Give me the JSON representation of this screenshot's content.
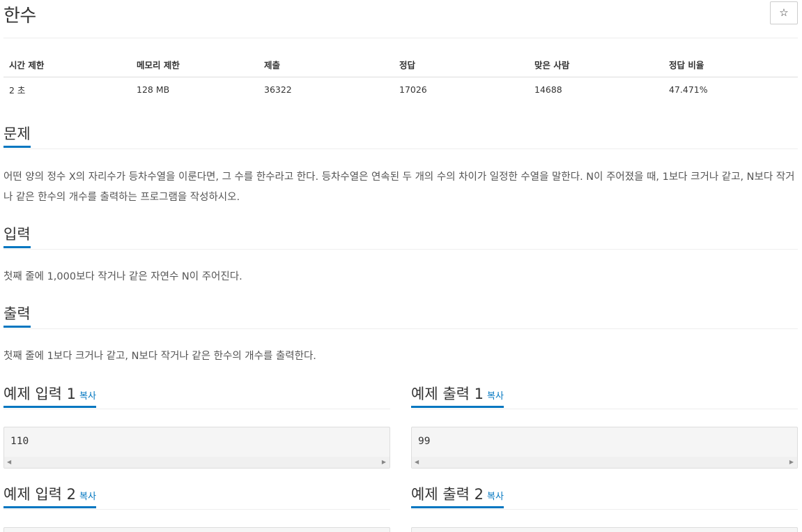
{
  "problem": {
    "title": "한수",
    "star_icon": "☆"
  },
  "info_table": {
    "headers": [
      "시간 제한",
      "메모리 제한",
      "제출",
      "정답",
      "맞은 사람",
      "정답 비율"
    ],
    "values": [
      "2 초",
      "128 MB",
      "36322",
      "17026",
      "14688",
      "47.471%"
    ]
  },
  "sections": {
    "description": {
      "heading": "문제",
      "text": "어떤 양의 정수 X의 자리수가 등차수열을 이룬다면, 그 수를 한수라고 한다. 등차수열은 연속된 두 개의 수의 차이가 일정한 수열을 말한다. N이 주어졌을 때, 1보다 크거나 같고, N보다 작거나 같은 한수의 개수를 출력하는 프로그램을 작성하시오."
    },
    "input": {
      "heading": "입력",
      "text": "첫째 줄에 1,000보다 작거나 같은 자연수 N이 주어진다."
    },
    "output": {
      "heading": "출력",
      "text": "첫째 줄에 1보다 크거나 같고, N보다 작거나 같은 한수의 개수를 출력한다."
    }
  },
  "samples": {
    "copy_label": "복사",
    "input1": {
      "heading": "예제 입력 1",
      "value": "110"
    },
    "output1": {
      "heading": "예제 출력 1",
      "value": "99"
    },
    "input2": {
      "heading": "예제 입력 2"
    },
    "output2": {
      "heading": "예제 출력 2"
    }
  },
  "colors": {
    "accent": "#0076c0",
    "sample_bg": "#f5f5f5"
  }
}
